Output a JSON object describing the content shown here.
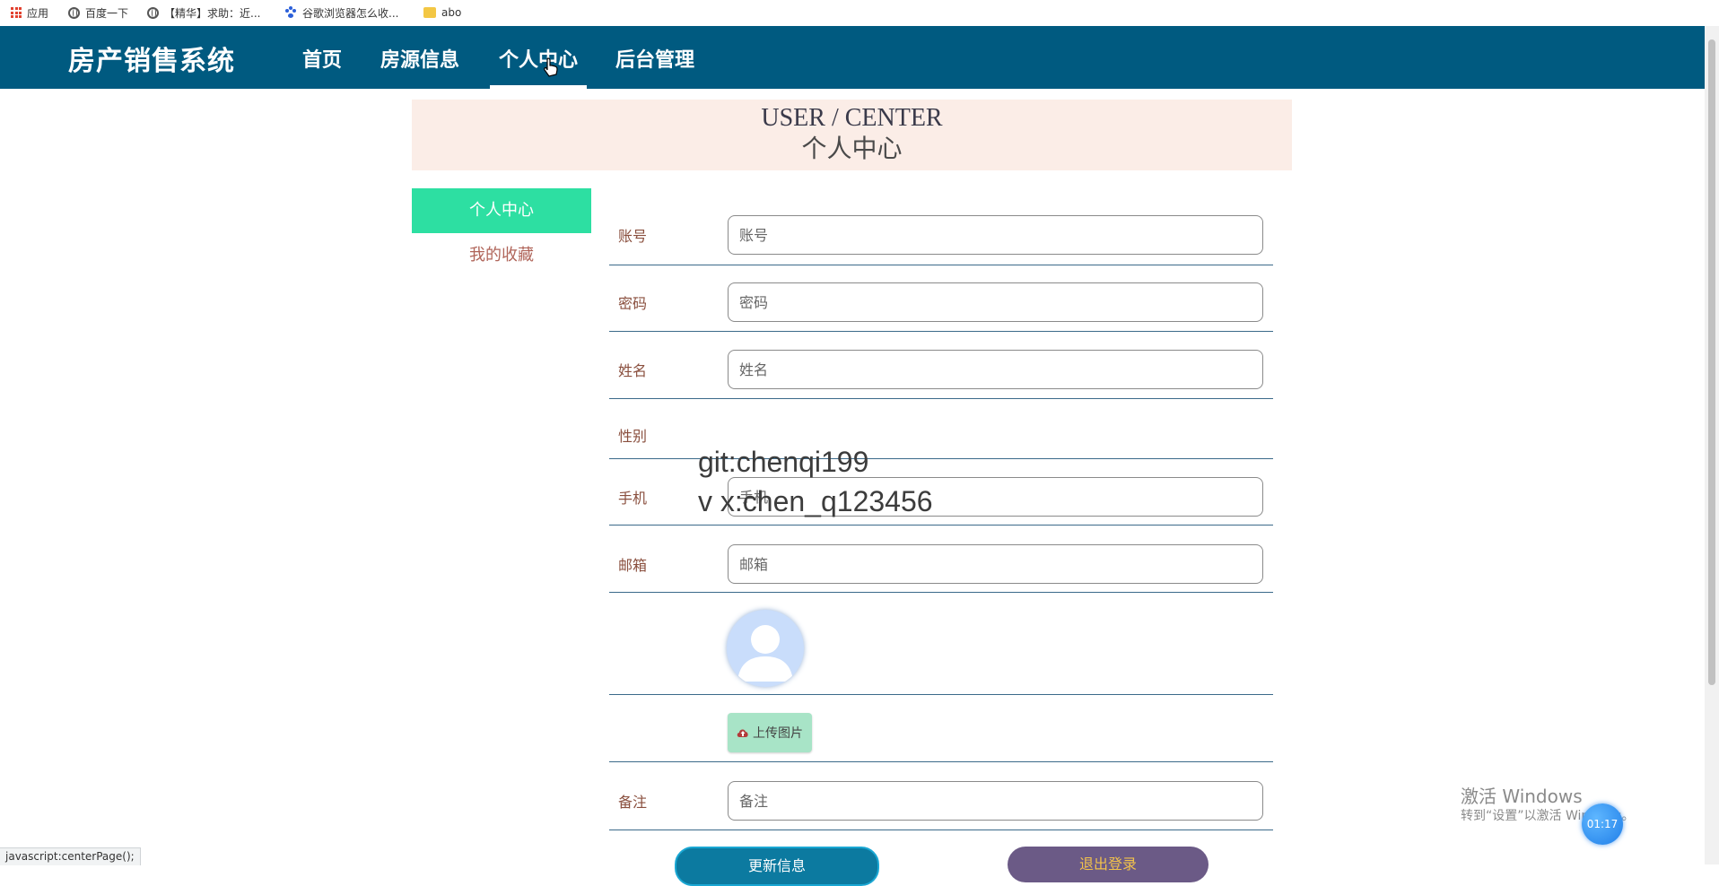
{
  "bookmarks": {
    "items": [
      {
        "label": "应用",
        "icon": "apps-grid-icon"
      },
      {
        "label": "百度一下",
        "icon": "globe-icon"
      },
      {
        "label": "【精华】求助：近...",
        "icon": "globe-icon"
      },
      {
        "label": "谷歌浏览器怎么收...",
        "icon": "baidu-paw-icon"
      },
      {
        "label": "abo",
        "icon": "folder-icon"
      }
    ]
  },
  "nav": {
    "brand": "房产销售系统",
    "items": [
      "首页",
      "房源信息",
      "个人中心",
      "后台管理"
    ],
    "active_index": 2
  },
  "banner": {
    "en": "USER / CENTER",
    "cn": "个人中心"
  },
  "sidebar": {
    "items": [
      {
        "label": "个人中心",
        "active": true
      },
      {
        "label": "我的收藏",
        "active": false
      }
    ]
  },
  "form": {
    "account": {
      "label": "账号",
      "placeholder": "账号"
    },
    "password": {
      "label": "密码",
      "placeholder": "密码"
    },
    "name": {
      "label": "姓名",
      "placeholder": "姓名"
    },
    "gender": {
      "label": "性别"
    },
    "phone": {
      "label": "手机",
      "placeholder": "手机"
    },
    "email": {
      "label": "邮箱",
      "placeholder": "邮箱"
    },
    "upload_label": "上传图片",
    "remark": {
      "label": "备注",
      "placeholder": "备注"
    },
    "update_button": "更新信息",
    "logout_button": "退出登录"
  },
  "watermark": {
    "line1": "git:chenqi199",
    "line2": "v x:chen_q123456"
  },
  "system": {
    "activate_title": "激活 Windows",
    "activate_sub": "转到“设置”以激活 Windows。",
    "timer": "01:17",
    "status_url": "javascript:centerPage();"
  },
  "colors": {
    "nav_bg": "#005a80",
    "banner_bg": "#fbede7",
    "sidebar_active": "#2ddfa2",
    "upload_bg": "#a8e4c7",
    "update_bg": "#0c7aa0",
    "logout_bg": "#6b5a86"
  }
}
